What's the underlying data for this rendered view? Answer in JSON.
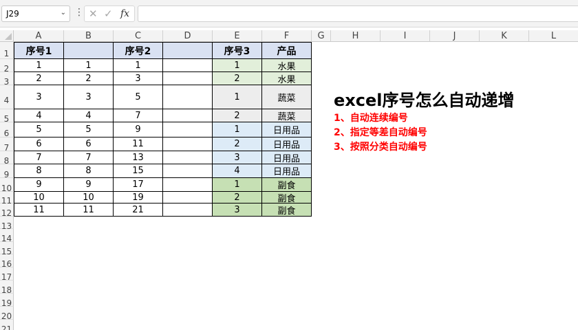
{
  "formula_bar": {
    "name_box": "J29",
    "more_icon": "ellipsis-vertical-icon",
    "cancel_icon": "✕",
    "enter_icon": "✓",
    "fx_label": "fx",
    "formula": ""
  },
  "columns": [
    "A",
    "B",
    "C",
    "D",
    "E",
    "F",
    "G",
    "H",
    "I",
    "J",
    "K",
    "L"
  ],
  "rows": [
    "1",
    "2",
    "3",
    "4",
    "5",
    "6",
    "7",
    "8",
    "9",
    "10",
    "11",
    "12",
    "13",
    "14",
    "15",
    "16",
    "17",
    "18",
    "19",
    "20",
    "21"
  ],
  "table": {
    "headers": {
      "A": "序号1",
      "B": "",
      "C": "序号2",
      "D": "",
      "E": "序号3",
      "F": "产品"
    },
    "data": [
      {
        "A": "1",
        "B": "1",
        "C": "1",
        "D": "",
        "E": "1",
        "F": "水果"
      },
      {
        "A": "2",
        "B": "2",
        "C": "3",
        "D": "",
        "E": "2",
        "F": "水果"
      },
      {
        "A": "3",
        "B": "3",
        "C": "5",
        "D": "",
        "E": "1",
        "F": "蔬菜"
      },
      {
        "A": "4",
        "B": "4",
        "C": "7",
        "D": "",
        "E": "2",
        "F": "蔬菜"
      },
      {
        "A": "5",
        "B": "5",
        "C": "9",
        "D": "",
        "E": "1",
        "F": "日用品"
      },
      {
        "A": "6",
        "B": "6",
        "C": "11",
        "D": "",
        "E": "2",
        "F": "日用品"
      },
      {
        "A": "7",
        "B": "7",
        "C": "13",
        "D": "",
        "E": "3",
        "F": "日用品"
      },
      {
        "A": "8",
        "B": "8",
        "C": "15",
        "D": "",
        "E": "4",
        "F": "日用品"
      },
      {
        "A": "9",
        "B": "9",
        "C": "17",
        "D": "",
        "E": "1",
        "F": "副食"
      },
      {
        "A": "10",
        "B": "10",
        "C": "19",
        "D": "",
        "E": "2",
        "F": "副食"
      },
      {
        "A": "11",
        "B": "11",
        "C": "21",
        "D": "",
        "E": "3",
        "F": "副食"
      }
    ],
    "group_colors": {
      "水果": "#e2efda",
      "蔬菜": "#ededed",
      "日用品": "#ddebf7",
      "副食": "#c6e0b4"
    },
    "header_color": "#d9e1f2"
  },
  "notes": {
    "title": "excel序号怎么自动递增",
    "lines": [
      "1、自动连续编号",
      "2、指定等差自动编号",
      "3、按照分类自动编号"
    ],
    "line_color": "#ff0000"
  }
}
